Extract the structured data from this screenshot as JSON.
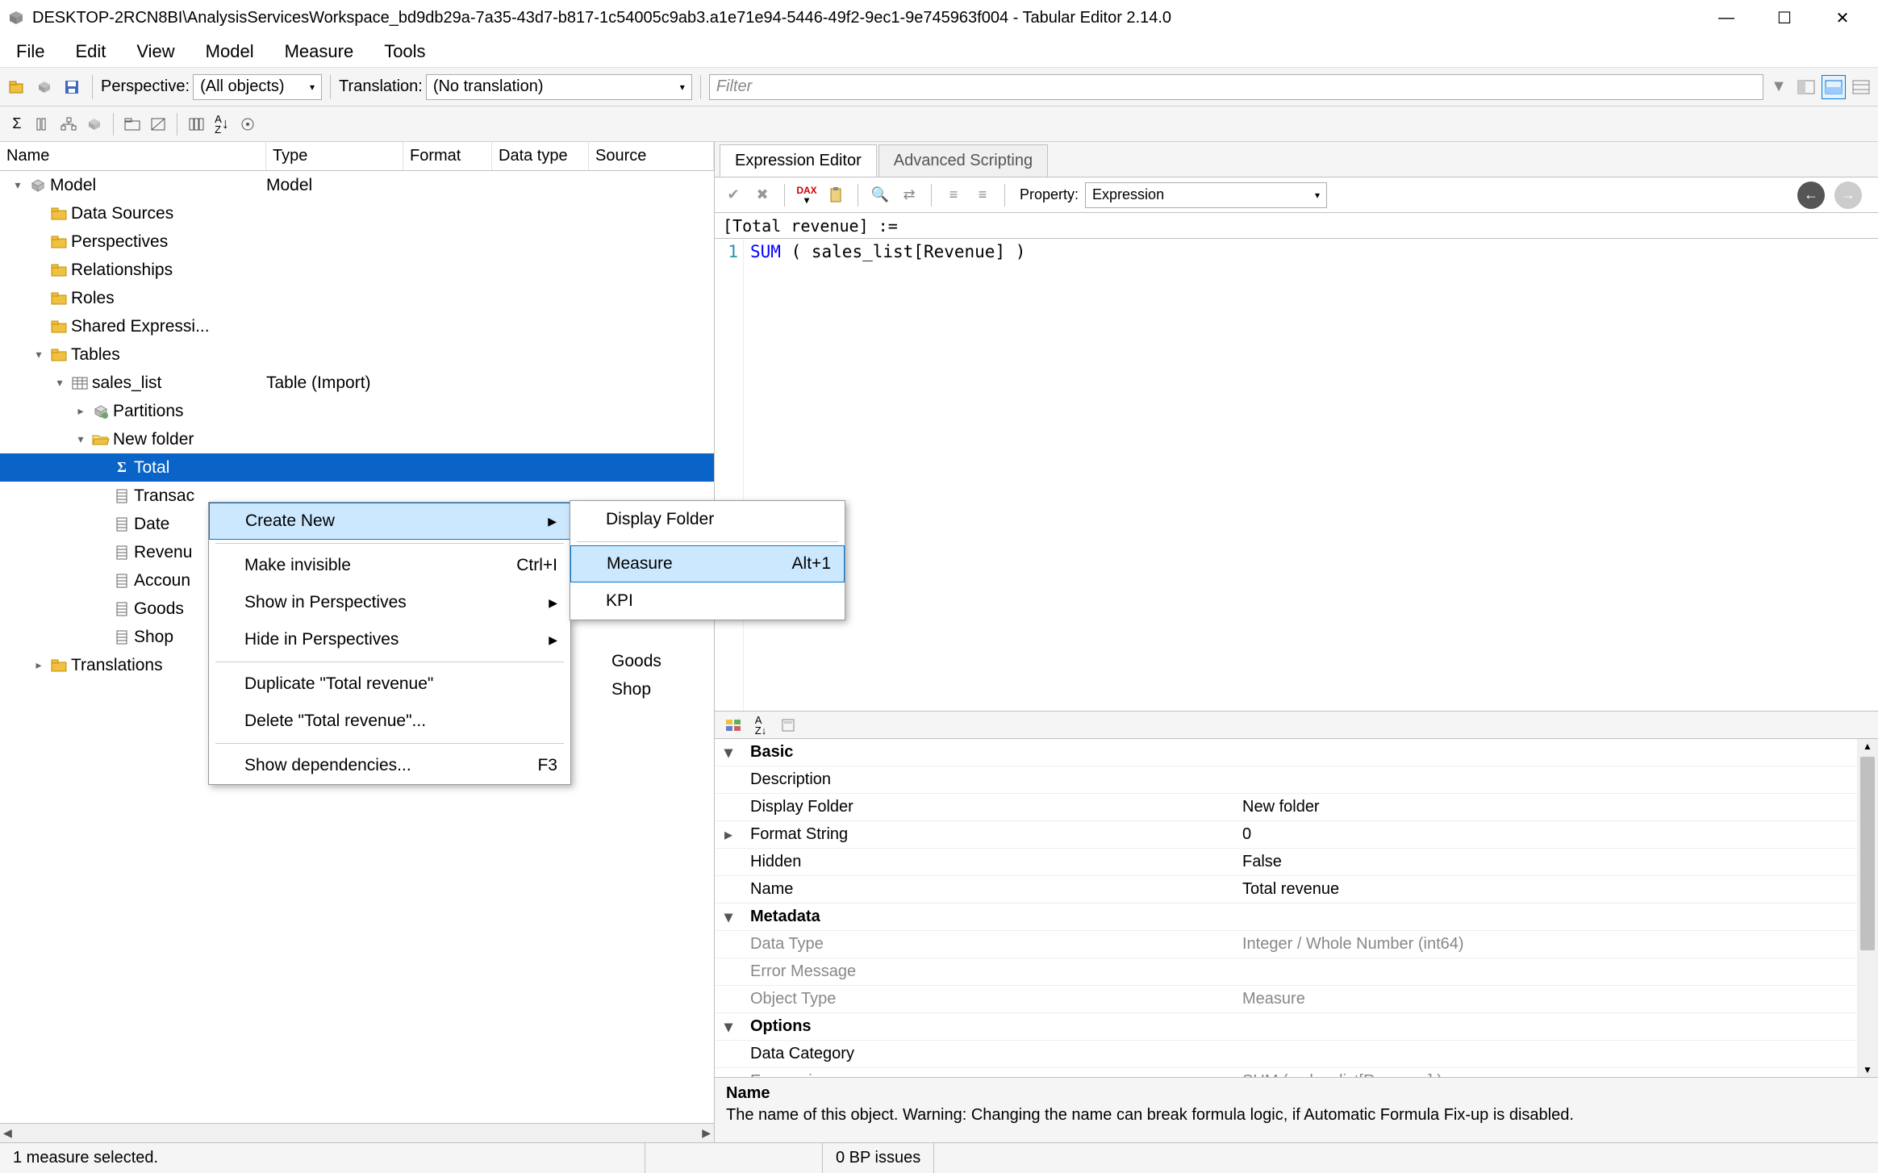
{
  "title": "DESKTOP-2RCN8BI\\AnalysisServicesWorkspace_bd9db29a-7a35-43d7-b817-1c54005c9ab3.a1e71e94-5446-49f2-9ec1-9e745963f004 - Tabular Editor 2.14.0",
  "menubar": {
    "file": "File",
    "edit": "Edit",
    "view": "View",
    "model": "Model",
    "measure": "Measure",
    "tools": "Tools"
  },
  "toolbar1": {
    "perspective_label": "Perspective:",
    "perspective_value": "(All objects)",
    "translation_label": "Translation:",
    "translation_value": "(No translation)",
    "filter_placeholder": "Filter"
  },
  "tree": {
    "cols": {
      "name": "Name",
      "type": "Type",
      "format": "Format",
      "datatype": "Data type",
      "source": "Source"
    },
    "rows": [
      {
        "indent": 0,
        "exp": "▾",
        "icon": "cube",
        "name": "Model",
        "type": "Model"
      },
      {
        "indent": 1,
        "exp": "",
        "icon": "folder",
        "name": "Data Sources"
      },
      {
        "indent": 1,
        "exp": "",
        "icon": "folder",
        "name": "Perspectives"
      },
      {
        "indent": 1,
        "exp": "",
        "icon": "folder",
        "name": "Relationships"
      },
      {
        "indent": 1,
        "exp": "",
        "icon": "folder",
        "name": "Roles"
      },
      {
        "indent": 1,
        "exp": "",
        "icon": "folder",
        "name": "Shared Expressi..."
      },
      {
        "indent": 1,
        "exp": "▾",
        "icon": "folder",
        "name": "Tables"
      },
      {
        "indent": 2,
        "exp": "▾",
        "icon": "table",
        "name": "sales_list",
        "type": "Table (Import)"
      },
      {
        "indent": 3,
        "exp": "▸",
        "icon": "part",
        "name": "Partitions"
      },
      {
        "indent": 3,
        "exp": "▾",
        "icon": "openfolder",
        "name": "New folder"
      },
      {
        "indent": 4,
        "exp": "",
        "icon": "sigma",
        "name": "Total",
        "sel": true
      },
      {
        "indent": 4,
        "exp": "",
        "icon": "col",
        "name": "Transac"
      },
      {
        "indent": 4,
        "exp": "",
        "icon": "col",
        "name": "Date"
      },
      {
        "indent": 4,
        "exp": "",
        "icon": "col",
        "name": "Revenu"
      },
      {
        "indent": 4,
        "exp": "",
        "icon": "col",
        "name": "Accoun"
      },
      {
        "indent": 4,
        "exp": "",
        "icon": "col",
        "name": "Goods"
      },
      {
        "indent": 4,
        "exp": "",
        "icon": "col",
        "name": "Shop"
      },
      {
        "indent": 1,
        "exp": "▸",
        "icon": "folder",
        "name": "Translations"
      }
    ],
    "extra_cols_visible": [
      "Goods",
      "Shop"
    ]
  },
  "tabs": {
    "expr": "Expression Editor",
    "adv": "Advanced Scripting"
  },
  "editor": {
    "property_label": "Property:",
    "property_value": "Expression",
    "title": "[Total revenue] :=",
    "line_kw": "SUM",
    "line_rest": " ( sales_list[Revenue] )"
  },
  "propgrid": {
    "rows": [
      {
        "cat": true,
        "exp": "▾",
        "name": "Basic"
      },
      {
        "name": "Description",
        "val": ""
      },
      {
        "name": "Display Folder",
        "val": "New folder"
      },
      {
        "exp": "▸",
        "name": "Format String",
        "val": "0"
      },
      {
        "name": "Hidden",
        "val": "False"
      },
      {
        "name": "Name",
        "val": "Total revenue"
      },
      {
        "cat": true,
        "exp": "▾",
        "name": "Metadata"
      },
      {
        "dis": true,
        "name": "Data Type",
        "val": "Integer / Whole Number (int64)"
      },
      {
        "dis": true,
        "name": "Error Message",
        "val": ""
      },
      {
        "dis": true,
        "name": "Object Type",
        "val": "Measure"
      },
      {
        "cat": true,
        "exp": "▾",
        "name": "Options"
      },
      {
        "name": "Data Category",
        "val": ""
      },
      {
        "dis": true,
        "name": "Expression",
        "val": "SUM ( sales_list[Revenue] )"
      }
    ],
    "desc_name": "Name",
    "desc_text": "The name of this object. Warning: Changing the name can break formula logic, if Automatic Formula Fix-up is disabled."
  },
  "statusbar": {
    "left": "1 measure selected.",
    "mid": "0 BP issues"
  },
  "ctx": {
    "create_new": "Create New",
    "make_invisible": "Make invisible",
    "make_invisible_sc": "Ctrl+I",
    "show_persp": "Show in Perspectives",
    "hide_persp": "Hide in Perspectives",
    "duplicate": "Duplicate \"Total revenue\"",
    "delete": "Delete \"Total revenue\"...",
    "show_deps": "Show dependencies...",
    "show_deps_sc": "F3",
    "sub_display_folder": "Display Folder",
    "sub_measure": "Measure",
    "sub_measure_sc": "Alt+1",
    "sub_kpi": "KPI"
  }
}
